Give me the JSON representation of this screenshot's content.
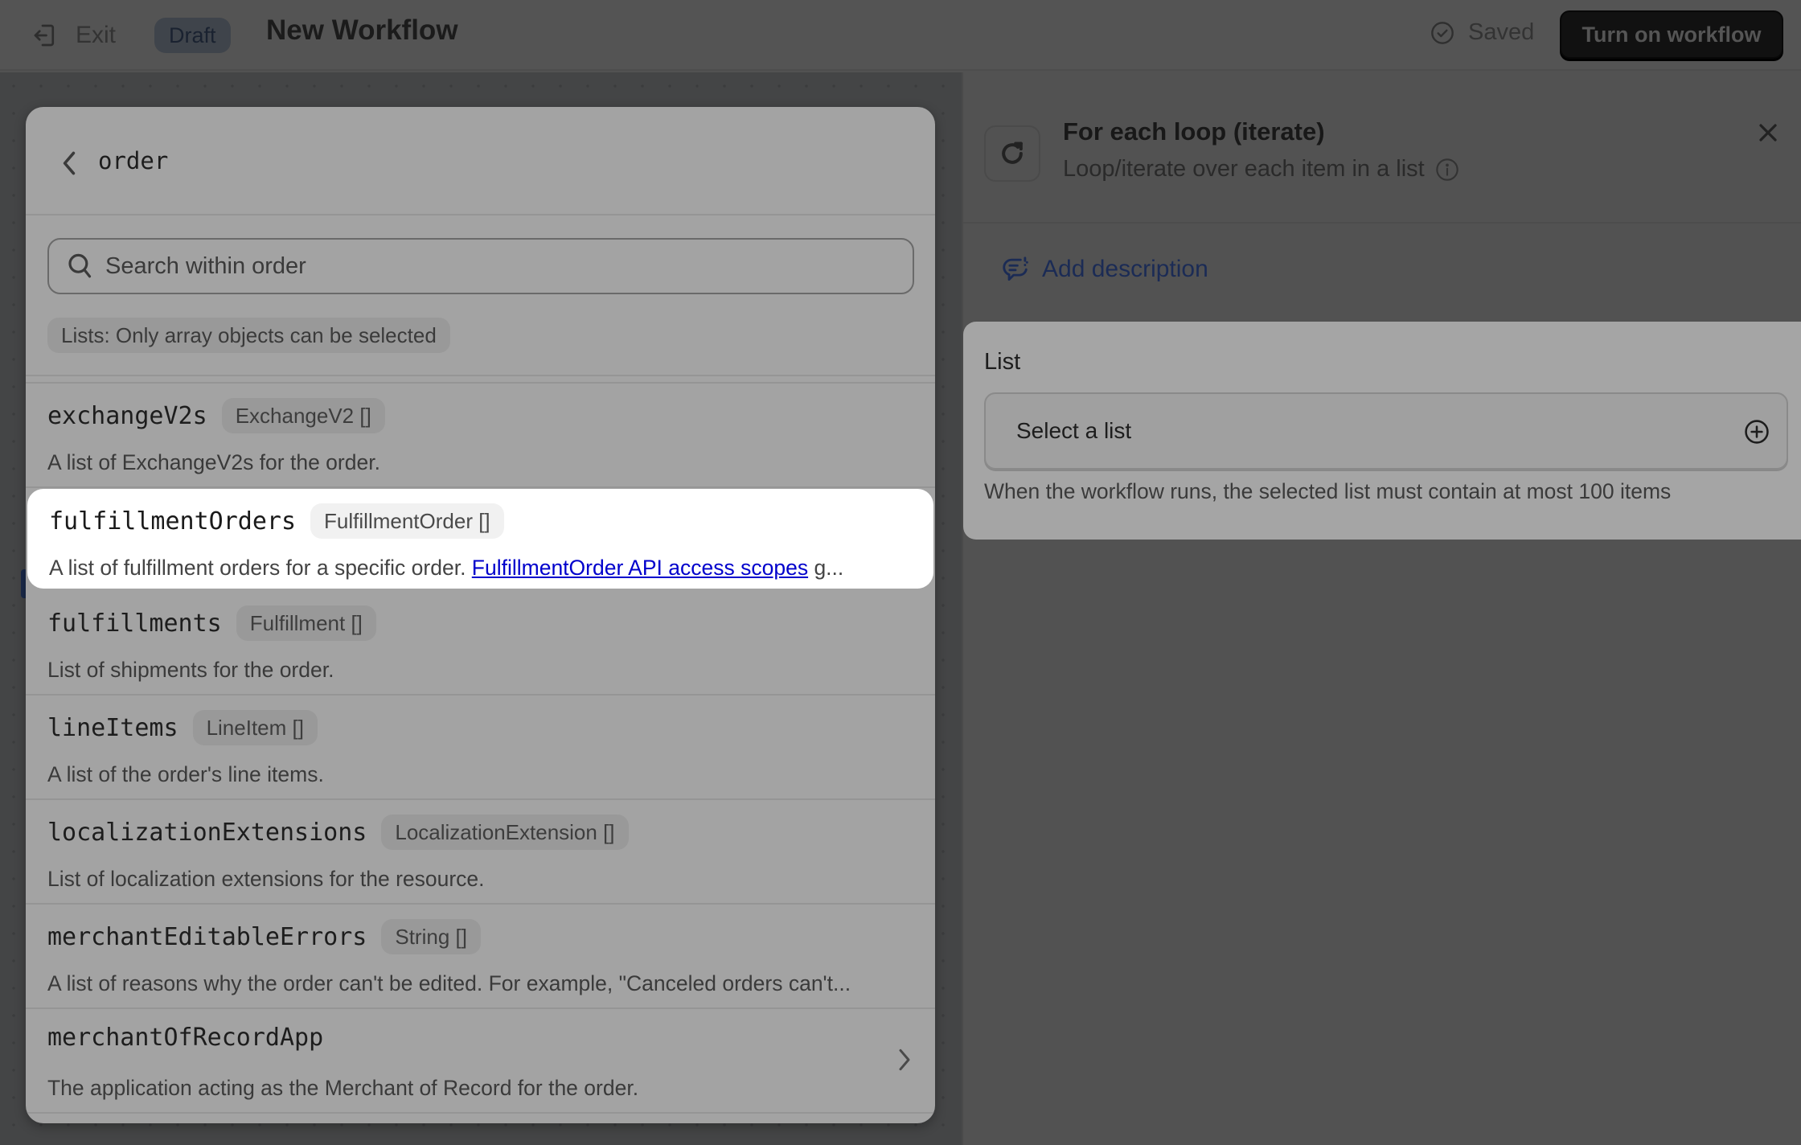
{
  "header": {
    "exit_label": "Exit",
    "status_badge": "Draft",
    "title": "New Workflow",
    "saved_label": "Saved",
    "turn_on_label": "Turn on workflow"
  },
  "picker": {
    "title": "order",
    "search_placeholder": "Search within order",
    "search_value": "",
    "hint": "Lists: Only array objects can be selected",
    "items": [
      {
        "name": "exchangeV2s",
        "type": "ExchangeV2 []",
        "desc": "A list of ExchangeV2s for the order."
      },
      {
        "name": "fulfillmentOrders",
        "type": "FulfillmentOrder []",
        "desc_prefix": "A list of fulfillment orders for a specific order. ",
        "desc_link": "FulfillmentOrder API access scopes",
        "desc_suffix": " g...",
        "highlighted": true
      },
      {
        "name": "fulfillments",
        "type": "Fulfillment []",
        "desc": "List of shipments for the order."
      },
      {
        "name": "lineItems",
        "type": "LineItem []",
        "desc": "A list of the order's line items."
      },
      {
        "name": "localizationExtensions",
        "type": "LocalizationExtension []",
        "desc": "List of localization extensions for the resource."
      },
      {
        "name": "merchantEditableErrors",
        "type": "String []",
        "desc": "A list of reasons why the order can't be edited. For example, \"Canceled orders can't..."
      },
      {
        "name": "merchantOfRecordApp",
        "type": "",
        "desc": "The application acting as the Merchant of Record for the order.",
        "has_children": true
      }
    ]
  },
  "panel": {
    "title": "For each loop (iterate)",
    "subtitle": "Loop/iterate over each item in a list",
    "add_description_label": "Add description",
    "list_label": "List",
    "select_placeholder": "Select a list",
    "list_help": "When the workflow runs, the selected list must contain at most 100 items"
  },
  "colors": {
    "link": "#0000cc",
    "accent_button_bg": "#111111",
    "add_description": "#1b2b55"
  }
}
